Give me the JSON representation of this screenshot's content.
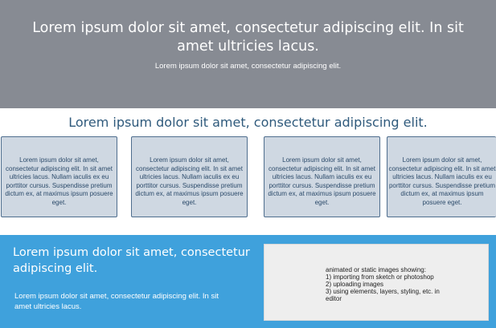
{
  "hero": {
    "title": "Lorem ipsum dolor sit amet, consectetur adipiscing elit. In sit amet ultricies lacus.",
    "subtitle": "Lorem ipsum dolor sit amet, consectetur adipiscing elit."
  },
  "features": {
    "title": "Lorem ipsum dolor sit amet, consectetur adipiscing elit.",
    "cards": [
      {
        "text": "Lorem ipsum dolor sit amet, consectetur adipiscing elit. In sit amet ultricies lacus. Nullam iaculis ex eu porttitor cursus. Suspendisse pretium dictum ex, at maximus ipsum posuere eget."
      },
      {
        "text": "Lorem ipsum dolor sit amet, consectetur adipiscing elit. In sit amet ultricies lacus. Nullam iaculis ex eu porttitor cursus. Suspendisse pretium dictum ex, at maximus ipsum posuere eget."
      },
      {
        "text": "Lorem ipsum dolor sit amet, consectetur adipiscing elit. In sit amet ultricies lacus. Nullam iaculis ex eu porttitor cursus. Suspendisse pretium dictum ex, at maximus ipsum posuere eget."
      },
      {
        "text": "Lorem ipsum dolor sit amet, consectetur adipiscing elit. In sit amet ultricies lacus. Nullam iaculis ex eu porttitor cursus. Suspendisse pretium dictum ex, at maximus ipsum posuere eget."
      }
    ]
  },
  "band": {
    "title": "Lorem ipsum dolor sit amet, consectetur adipiscing elit.",
    "text": "Lorem ipsum dolor sit amet, consectetur adipiscing elit. In sit amet ultricies lacus.",
    "media_lines": [
      "animated or static images showing:",
      "1) importing from sketch or photoshop",
      "2) uploading images",
      "3) using elements, layers, styling, etc. in",
      "editor"
    ]
  },
  "colors": {
    "hero_bg": "#878b93",
    "accent_band": "#3fa1dc",
    "card_bg": "#cfd8e2",
    "heading_blue": "#2f5a7c"
  }
}
